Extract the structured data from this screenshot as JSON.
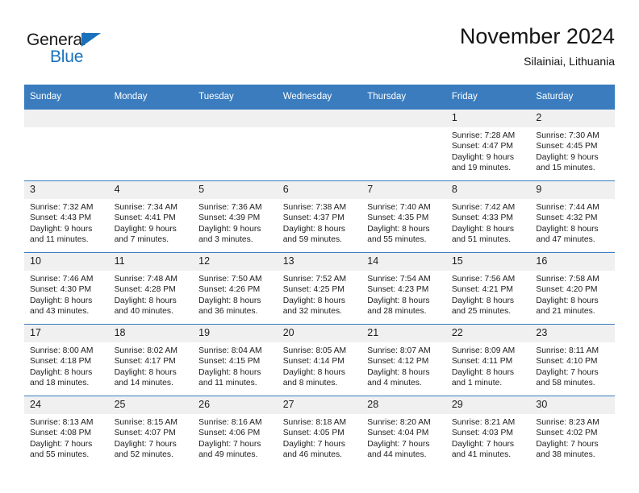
{
  "brand": {
    "name_part1": "General",
    "name_part2": "Blue",
    "triangle_color": "#1a72bd",
    "text_color": "#1a1a1a"
  },
  "header": {
    "title": "November 2024",
    "subtitle": "Silainiai, Lithuania"
  },
  "theme": {
    "header_bg": "#3a7cbe",
    "header_text": "#ffffff",
    "daynum_bg": "#f0f0f0",
    "rule_color": "#3a7cbe"
  },
  "weekdays": [
    "Sunday",
    "Monday",
    "Tuesday",
    "Wednesday",
    "Thursday",
    "Friday",
    "Saturday"
  ],
  "weeks": [
    [
      {
        "day": "",
        "sunrise": "",
        "sunset": "",
        "daylight1": "",
        "daylight2": ""
      },
      {
        "day": "",
        "sunrise": "",
        "sunset": "",
        "daylight1": "",
        "daylight2": ""
      },
      {
        "day": "",
        "sunrise": "",
        "sunset": "",
        "daylight1": "",
        "daylight2": ""
      },
      {
        "day": "",
        "sunrise": "",
        "sunset": "",
        "daylight1": "",
        "daylight2": ""
      },
      {
        "day": "",
        "sunrise": "",
        "sunset": "",
        "daylight1": "",
        "daylight2": ""
      },
      {
        "day": "1",
        "sunrise": "Sunrise: 7:28 AM",
        "sunset": "Sunset: 4:47 PM",
        "daylight1": "Daylight: 9 hours",
        "daylight2": "and 19 minutes."
      },
      {
        "day": "2",
        "sunrise": "Sunrise: 7:30 AM",
        "sunset": "Sunset: 4:45 PM",
        "daylight1": "Daylight: 9 hours",
        "daylight2": "and 15 minutes."
      }
    ],
    [
      {
        "day": "3",
        "sunrise": "Sunrise: 7:32 AM",
        "sunset": "Sunset: 4:43 PM",
        "daylight1": "Daylight: 9 hours",
        "daylight2": "and 11 minutes."
      },
      {
        "day": "4",
        "sunrise": "Sunrise: 7:34 AM",
        "sunset": "Sunset: 4:41 PM",
        "daylight1": "Daylight: 9 hours",
        "daylight2": "and 7 minutes."
      },
      {
        "day": "5",
        "sunrise": "Sunrise: 7:36 AM",
        "sunset": "Sunset: 4:39 PM",
        "daylight1": "Daylight: 9 hours",
        "daylight2": "and 3 minutes."
      },
      {
        "day": "6",
        "sunrise": "Sunrise: 7:38 AM",
        "sunset": "Sunset: 4:37 PM",
        "daylight1": "Daylight: 8 hours",
        "daylight2": "and 59 minutes."
      },
      {
        "day": "7",
        "sunrise": "Sunrise: 7:40 AM",
        "sunset": "Sunset: 4:35 PM",
        "daylight1": "Daylight: 8 hours",
        "daylight2": "and 55 minutes."
      },
      {
        "day": "8",
        "sunrise": "Sunrise: 7:42 AM",
        "sunset": "Sunset: 4:33 PM",
        "daylight1": "Daylight: 8 hours",
        "daylight2": "and 51 minutes."
      },
      {
        "day": "9",
        "sunrise": "Sunrise: 7:44 AM",
        "sunset": "Sunset: 4:32 PM",
        "daylight1": "Daylight: 8 hours",
        "daylight2": "and 47 minutes."
      }
    ],
    [
      {
        "day": "10",
        "sunrise": "Sunrise: 7:46 AM",
        "sunset": "Sunset: 4:30 PM",
        "daylight1": "Daylight: 8 hours",
        "daylight2": "and 43 minutes."
      },
      {
        "day": "11",
        "sunrise": "Sunrise: 7:48 AM",
        "sunset": "Sunset: 4:28 PM",
        "daylight1": "Daylight: 8 hours",
        "daylight2": "and 40 minutes."
      },
      {
        "day": "12",
        "sunrise": "Sunrise: 7:50 AM",
        "sunset": "Sunset: 4:26 PM",
        "daylight1": "Daylight: 8 hours",
        "daylight2": "and 36 minutes."
      },
      {
        "day": "13",
        "sunrise": "Sunrise: 7:52 AM",
        "sunset": "Sunset: 4:25 PM",
        "daylight1": "Daylight: 8 hours",
        "daylight2": "and 32 minutes."
      },
      {
        "day": "14",
        "sunrise": "Sunrise: 7:54 AM",
        "sunset": "Sunset: 4:23 PM",
        "daylight1": "Daylight: 8 hours",
        "daylight2": "and 28 minutes."
      },
      {
        "day": "15",
        "sunrise": "Sunrise: 7:56 AM",
        "sunset": "Sunset: 4:21 PM",
        "daylight1": "Daylight: 8 hours",
        "daylight2": "and 25 minutes."
      },
      {
        "day": "16",
        "sunrise": "Sunrise: 7:58 AM",
        "sunset": "Sunset: 4:20 PM",
        "daylight1": "Daylight: 8 hours",
        "daylight2": "and 21 minutes."
      }
    ],
    [
      {
        "day": "17",
        "sunrise": "Sunrise: 8:00 AM",
        "sunset": "Sunset: 4:18 PM",
        "daylight1": "Daylight: 8 hours",
        "daylight2": "and 18 minutes."
      },
      {
        "day": "18",
        "sunrise": "Sunrise: 8:02 AM",
        "sunset": "Sunset: 4:17 PM",
        "daylight1": "Daylight: 8 hours",
        "daylight2": "and 14 minutes."
      },
      {
        "day": "19",
        "sunrise": "Sunrise: 8:04 AM",
        "sunset": "Sunset: 4:15 PM",
        "daylight1": "Daylight: 8 hours",
        "daylight2": "and 11 minutes."
      },
      {
        "day": "20",
        "sunrise": "Sunrise: 8:05 AM",
        "sunset": "Sunset: 4:14 PM",
        "daylight1": "Daylight: 8 hours",
        "daylight2": "and 8 minutes."
      },
      {
        "day": "21",
        "sunrise": "Sunrise: 8:07 AM",
        "sunset": "Sunset: 4:12 PM",
        "daylight1": "Daylight: 8 hours",
        "daylight2": "and 4 minutes."
      },
      {
        "day": "22",
        "sunrise": "Sunrise: 8:09 AM",
        "sunset": "Sunset: 4:11 PM",
        "daylight1": "Daylight: 8 hours",
        "daylight2": "and 1 minute."
      },
      {
        "day": "23",
        "sunrise": "Sunrise: 8:11 AM",
        "sunset": "Sunset: 4:10 PM",
        "daylight1": "Daylight: 7 hours",
        "daylight2": "and 58 minutes."
      }
    ],
    [
      {
        "day": "24",
        "sunrise": "Sunrise: 8:13 AM",
        "sunset": "Sunset: 4:08 PM",
        "daylight1": "Daylight: 7 hours",
        "daylight2": "and 55 minutes."
      },
      {
        "day": "25",
        "sunrise": "Sunrise: 8:15 AM",
        "sunset": "Sunset: 4:07 PM",
        "daylight1": "Daylight: 7 hours",
        "daylight2": "and 52 minutes."
      },
      {
        "day": "26",
        "sunrise": "Sunrise: 8:16 AM",
        "sunset": "Sunset: 4:06 PM",
        "daylight1": "Daylight: 7 hours",
        "daylight2": "and 49 minutes."
      },
      {
        "day": "27",
        "sunrise": "Sunrise: 8:18 AM",
        "sunset": "Sunset: 4:05 PM",
        "daylight1": "Daylight: 7 hours",
        "daylight2": "and 46 minutes."
      },
      {
        "day": "28",
        "sunrise": "Sunrise: 8:20 AM",
        "sunset": "Sunset: 4:04 PM",
        "daylight1": "Daylight: 7 hours",
        "daylight2": "and 44 minutes."
      },
      {
        "day": "29",
        "sunrise": "Sunrise: 8:21 AM",
        "sunset": "Sunset: 4:03 PM",
        "daylight1": "Daylight: 7 hours",
        "daylight2": "and 41 minutes."
      },
      {
        "day": "30",
        "sunrise": "Sunrise: 8:23 AM",
        "sunset": "Sunset: 4:02 PM",
        "daylight1": "Daylight: 7 hours",
        "daylight2": "and 38 minutes."
      }
    ]
  ]
}
